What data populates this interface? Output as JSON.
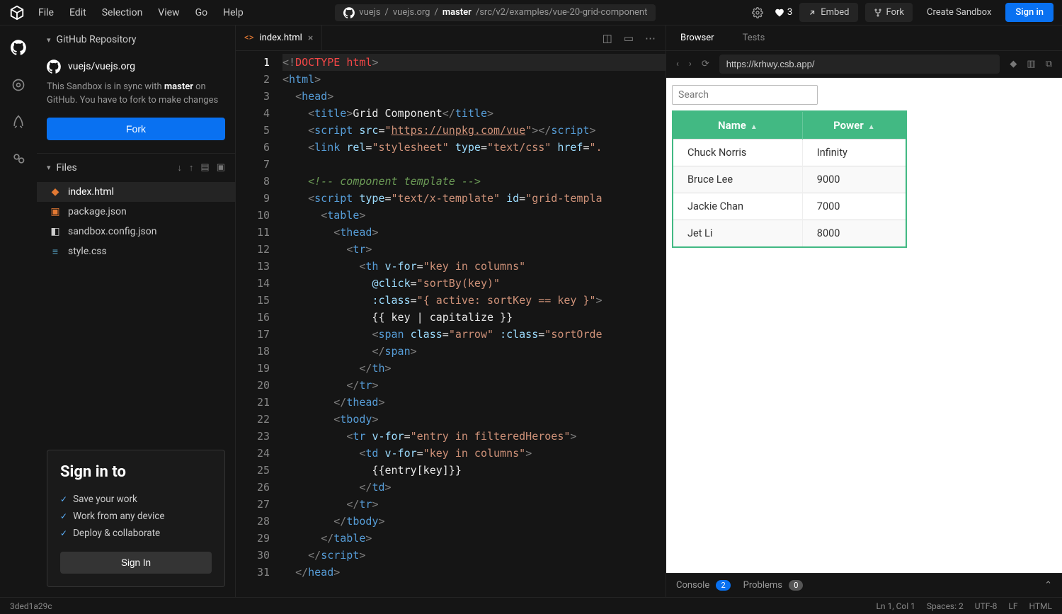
{
  "menubar": {
    "items": [
      "File",
      "Edit",
      "Selection",
      "View",
      "Go",
      "Help"
    ]
  },
  "breadcrumb": {
    "owner": "vuejs",
    "repo": "vuejs.org",
    "branch": "master",
    "path": "/src/v2/examples/vue-20-grid-component"
  },
  "topRight": {
    "likes": "3",
    "embed": "Embed",
    "fork": "Fork",
    "create": "Create Sandbox",
    "signin": "Sign in"
  },
  "sidebar": {
    "repoHeader": "GitHub Repository",
    "repoName": "vuejs/vuejs.org",
    "syncText1": "This Sandbox is in sync with ",
    "syncBold": "master",
    "syncText2": " on GitHub. You have to fork to make changes",
    "forkBtn": "Fork",
    "filesHeader": "Files",
    "files": [
      {
        "name": "index.html",
        "kind": "html",
        "active": true
      },
      {
        "name": "package.json",
        "kind": "json",
        "active": false
      },
      {
        "name": "sandbox.config.json",
        "kind": "box",
        "active": false
      },
      {
        "name": "style.css",
        "kind": "css",
        "active": false
      }
    ],
    "signinCard": {
      "title": "Sign in to",
      "benefits": [
        "Save your work",
        "Work from any device",
        "Deploy & collaborate"
      ],
      "button": "Sign In"
    }
  },
  "editor": {
    "tabName": "index.html",
    "lines": 31,
    "code": {
      "l4_title": "Grid Component",
      "l5_src": "https://unpkg.com/vue",
      "l6_rel": "stylesheet",
      "l6_type": "text/css",
      "l9_type": "text/x-template",
      "l9_id": "grid-templa",
      "l14_vfor": "key in columns",
      "l15_click": "sortBy(key)",
      "l16_class": "{ active: sortKey == key }",
      "l17_cls": "arrow",
      "l17_dcls": "sortOrde",
      "l23_vfor": "entry in filteredHeroes",
      "l24_vfor": "key in columns"
    }
  },
  "preview": {
    "tabs": {
      "browser": "Browser",
      "tests": "Tests"
    },
    "url": "https://krhwy.csb.app/",
    "searchPlaceholder": "Search",
    "columns": [
      "Name",
      "Power"
    ],
    "rows": [
      {
        "name": "Chuck Norris",
        "power": "Infinity"
      },
      {
        "name": "Bruce Lee",
        "power": "9000"
      },
      {
        "name": "Jackie Chan",
        "power": "7000"
      },
      {
        "name": "Jet Li",
        "power": "8000"
      }
    ],
    "footer": {
      "console": "Console",
      "consoleCount": "2",
      "problems": "Problems",
      "problemsCount": "0"
    }
  },
  "statusbar": {
    "left": "3ded1a29c",
    "lncol": "Ln 1, Col 1",
    "spaces": "Spaces: 2",
    "encoding": "UTF-8",
    "eol": "LF",
    "lang": "HTML"
  }
}
